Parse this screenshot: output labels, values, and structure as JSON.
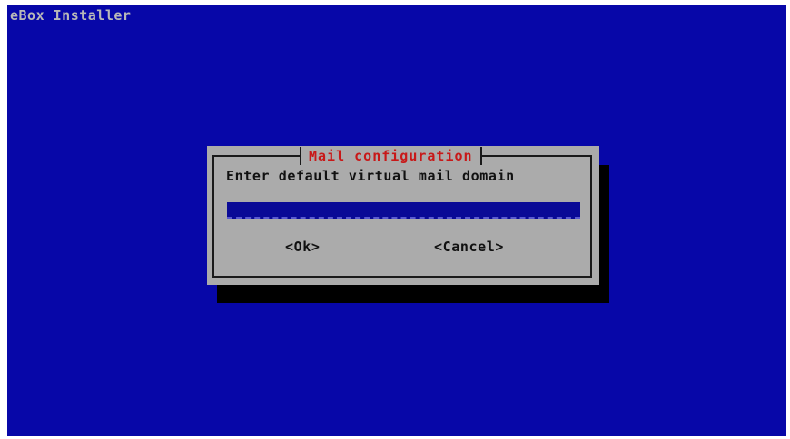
{
  "screen": {
    "installer_title": "eBox Installer"
  },
  "dialog": {
    "title": "Mail configuration",
    "prompt": "Enter default virtual mail domain",
    "input_value": "",
    "ok_label": "<Ok>",
    "cancel_label": "<Cancel>"
  },
  "colors": {
    "background": "#0707a8",
    "dialog": "#ababab",
    "title_text": "#c81818",
    "input_field": "#0a0a96",
    "shadow": "#000000"
  }
}
